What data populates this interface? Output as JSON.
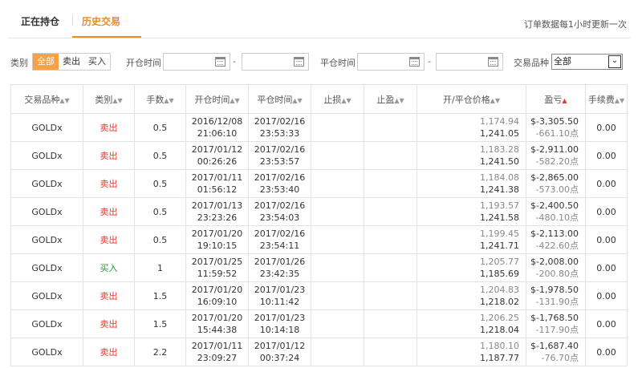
{
  "tabs": {
    "open": "正在持仓",
    "history": "历史交易",
    "note": "订单数据每1小时更新一次"
  },
  "filters": {
    "category_label": "类别",
    "category_options": [
      "全部",
      "卖出",
      "买入"
    ],
    "open_time_label": "开仓时间",
    "close_time_label": "平仓时间",
    "dash": "-",
    "product_label": "交易品种",
    "product_value": "全部"
  },
  "table": {
    "headers": [
      "交易品种",
      "类别",
      "手数",
      "开仓时间",
      "平仓时间",
      "止损",
      "止盈",
      "开/平仓价格",
      "盈亏",
      "手续费"
    ],
    "rows": [
      {
        "symbol": "GOLDx",
        "type": "卖出",
        "lots": "0.5",
        "open_date": "2016/12/08",
        "open_time": "21:06:10",
        "close_date": "2017/02/16",
        "close_time": "23:53:33",
        "sl": "",
        "tp": "",
        "open_price": "1,174.94",
        "close_price": "1,241.05",
        "pl": "$-3,305.50",
        "pts": "-661.10点",
        "fee": "0.00"
      },
      {
        "symbol": "GOLDx",
        "type": "卖出",
        "lots": "0.5",
        "open_date": "2017/01/12",
        "open_time": "00:26:26",
        "close_date": "2017/02/16",
        "close_time": "23:53:57",
        "sl": "",
        "tp": "",
        "open_price": "1,183.28",
        "close_price": "1,241.50",
        "pl": "$-2,911.00",
        "pts": "-582.20点",
        "fee": "0.00"
      },
      {
        "symbol": "GOLDx",
        "type": "卖出",
        "lots": "0.5",
        "open_date": "2017/01/11",
        "open_time": "01:56:12",
        "close_date": "2017/02/16",
        "close_time": "23:53:40",
        "sl": "",
        "tp": "",
        "open_price": "1,184.08",
        "close_price": "1,241.38",
        "pl": "$-2,865.00",
        "pts": "-573.00点",
        "fee": "0.00"
      },
      {
        "symbol": "GOLDx",
        "type": "卖出",
        "lots": "0.5",
        "open_date": "2017/01/13",
        "open_time": "23:23:26",
        "close_date": "2017/02/16",
        "close_time": "23:54:03",
        "sl": "",
        "tp": "",
        "open_price": "1,193.57",
        "close_price": "1,241.58",
        "pl": "$-2,400.50",
        "pts": "-480.10点",
        "fee": "0.00"
      },
      {
        "symbol": "GOLDx",
        "type": "卖出",
        "lots": "0.5",
        "open_date": "2017/01/20",
        "open_time": "19:10:15",
        "close_date": "2017/02/16",
        "close_time": "23:54:11",
        "sl": "",
        "tp": "",
        "open_price": "1,199.45",
        "close_price": "1,241.71",
        "pl": "$-2,113.00",
        "pts": "-422.60点",
        "fee": "0.00"
      },
      {
        "symbol": "GOLDx",
        "type": "买入",
        "lots": "1",
        "open_date": "2017/01/25",
        "open_time": "11:59:52",
        "close_date": "2017/01/26",
        "close_time": "23:42:35",
        "sl": "",
        "tp": "",
        "open_price": "1,205.77",
        "close_price": "1,185.69",
        "pl": "$-2,008.00",
        "pts": "-200.80点",
        "fee": "0.00"
      },
      {
        "symbol": "GOLDx",
        "type": "卖出",
        "lots": "1.5",
        "open_date": "2017/01/20",
        "open_time": "16:09:10",
        "close_date": "2017/01/23",
        "close_time": "10:11:42",
        "sl": "",
        "tp": "",
        "open_price": "1,204.83",
        "close_price": "1,218.02",
        "pl": "$-1,978.50",
        "pts": "-131.90点",
        "fee": "0.00"
      },
      {
        "symbol": "GOLDx",
        "type": "卖出",
        "lots": "1.5",
        "open_date": "2017/01/20",
        "open_time": "15:44:38",
        "close_date": "2017/01/23",
        "close_time": "10:14:18",
        "sl": "",
        "tp": "",
        "open_price": "1,206.25",
        "close_price": "1,218.04",
        "pl": "$-1,768.50",
        "pts": "-117.90点",
        "fee": "0.00"
      },
      {
        "symbol": "GOLDx",
        "type": "卖出",
        "lots": "2.2",
        "open_date": "2017/01/11",
        "open_time": "23:09:27",
        "close_date": "2017/01/12",
        "close_time": "00:37:24",
        "sl": "",
        "tp": "",
        "open_price": "1,180.10",
        "close_price": "1,187.77",
        "pl": "$-1,687.40",
        "pts": "-76.70点",
        "fee": "0.00"
      }
    ]
  },
  "colors": {
    "accent": "#f08a24",
    "sell": "#e8392b",
    "buy": "#1a9e2f"
  }
}
